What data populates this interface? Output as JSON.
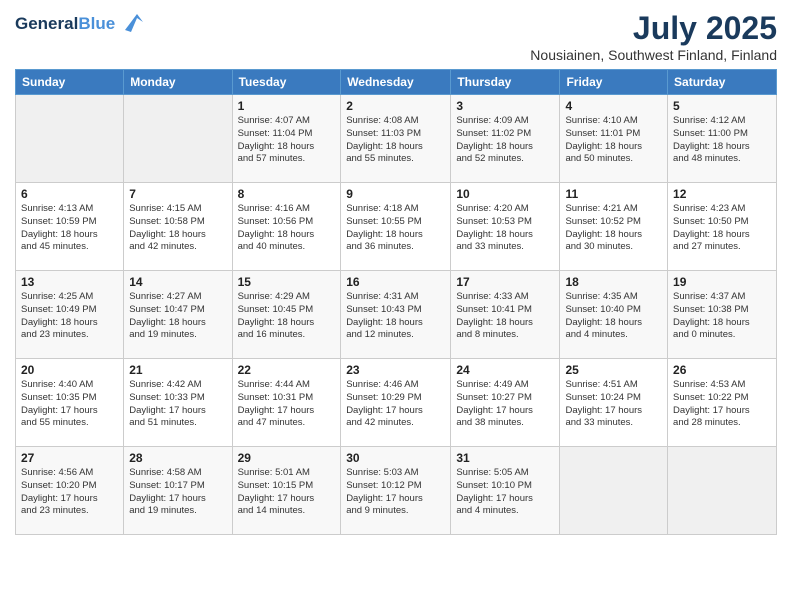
{
  "header": {
    "logo_line1": "General",
    "logo_line2": "Blue",
    "month": "July 2025",
    "location": "Nousiainen, Southwest Finland, Finland"
  },
  "weekdays": [
    "Sunday",
    "Monday",
    "Tuesday",
    "Wednesday",
    "Thursday",
    "Friday",
    "Saturday"
  ],
  "weeks": [
    [
      {
        "day": "",
        "info": ""
      },
      {
        "day": "",
        "info": ""
      },
      {
        "day": "1",
        "info": "Sunrise: 4:07 AM\nSunset: 11:04 PM\nDaylight: 18 hours\nand 57 minutes."
      },
      {
        "day": "2",
        "info": "Sunrise: 4:08 AM\nSunset: 11:03 PM\nDaylight: 18 hours\nand 55 minutes."
      },
      {
        "day": "3",
        "info": "Sunrise: 4:09 AM\nSunset: 11:02 PM\nDaylight: 18 hours\nand 52 minutes."
      },
      {
        "day": "4",
        "info": "Sunrise: 4:10 AM\nSunset: 11:01 PM\nDaylight: 18 hours\nand 50 minutes."
      },
      {
        "day": "5",
        "info": "Sunrise: 4:12 AM\nSunset: 11:00 PM\nDaylight: 18 hours\nand 48 minutes."
      }
    ],
    [
      {
        "day": "6",
        "info": "Sunrise: 4:13 AM\nSunset: 10:59 PM\nDaylight: 18 hours\nand 45 minutes."
      },
      {
        "day": "7",
        "info": "Sunrise: 4:15 AM\nSunset: 10:58 PM\nDaylight: 18 hours\nand 42 minutes."
      },
      {
        "day": "8",
        "info": "Sunrise: 4:16 AM\nSunset: 10:56 PM\nDaylight: 18 hours\nand 40 minutes."
      },
      {
        "day": "9",
        "info": "Sunrise: 4:18 AM\nSunset: 10:55 PM\nDaylight: 18 hours\nand 36 minutes."
      },
      {
        "day": "10",
        "info": "Sunrise: 4:20 AM\nSunset: 10:53 PM\nDaylight: 18 hours\nand 33 minutes."
      },
      {
        "day": "11",
        "info": "Sunrise: 4:21 AM\nSunset: 10:52 PM\nDaylight: 18 hours\nand 30 minutes."
      },
      {
        "day": "12",
        "info": "Sunrise: 4:23 AM\nSunset: 10:50 PM\nDaylight: 18 hours\nand 27 minutes."
      }
    ],
    [
      {
        "day": "13",
        "info": "Sunrise: 4:25 AM\nSunset: 10:49 PM\nDaylight: 18 hours\nand 23 minutes."
      },
      {
        "day": "14",
        "info": "Sunrise: 4:27 AM\nSunset: 10:47 PM\nDaylight: 18 hours\nand 19 minutes."
      },
      {
        "day": "15",
        "info": "Sunrise: 4:29 AM\nSunset: 10:45 PM\nDaylight: 18 hours\nand 16 minutes."
      },
      {
        "day": "16",
        "info": "Sunrise: 4:31 AM\nSunset: 10:43 PM\nDaylight: 18 hours\nand 12 minutes."
      },
      {
        "day": "17",
        "info": "Sunrise: 4:33 AM\nSunset: 10:41 PM\nDaylight: 18 hours\nand 8 minutes."
      },
      {
        "day": "18",
        "info": "Sunrise: 4:35 AM\nSunset: 10:40 PM\nDaylight: 18 hours\nand 4 minutes."
      },
      {
        "day": "19",
        "info": "Sunrise: 4:37 AM\nSunset: 10:38 PM\nDaylight: 18 hours\nand 0 minutes."
      }
    ],
    [
      {
        "day": "20",
        "info": "Sunrise: 4:40 AM\nSunset: 10:35 PM\nDaylight: 17 hours\nand 55 minutes."
      },
      {
        "day": "21",
        "info": "Sunrise: 4:42 AM\nSunset: 10:33 PM\nDaylight: 17 hours\nand 51 minutes."
      },
      {
        "day": "22",
        "info": "Sunrise: 4:44 AM\nSunset: 10:31 PM\nDaylight: 17 hours\nand 47 minutes."
      },
      {
        "day": "23",
        "info": "Sunrise: 4:46 AM\nSunset: 10:29 PM\nDaylight: 17 hours\nand 42 minutes."
      },
      {
        "day": "24",
        "info": "Sunrise: 4:49 AM\nSunset: 10:27 PM\nDaylight: 17 hours\nand 38 minutes."
      },
      {
        "day": "25",
        "info": "Sunrise: 4:51 AM\nSunset: 10:24 PM\nDaylight: 17 hours\nand 33 minutes."
      },
      {
        "day": "26",
        "info": "Sunrise: 4:53 AM\nSunset: 10:22 PM\nDaylight: 17 hours\nand 28 minutes."
      }
    ],
    [
      {
        "day": "27",
        "info": "Sunrise: 4:56 AM\nSunset: 10:20 PM\nDaylight: 17 hours\nand 23 minutes."
      },
      {
        "day": "28",
        "info": "Sunrise: 4:58 AM\nSunset: 10:17 PM\nDaylight: 17 hours\nand 19 minutes."
      },
      {
        "day": "29",
        "info": "Sunrise: 5:01 AM\nSunset: 10:15 PM\nDaylight: 17 hours\nand 14 minutes."
      },
      {
        "day": "30",
        "info": "Sunrise: 5:03 AM\nSunset: 10:12 PM\nDaylight: 17 hours\nand 9 minutes."
      },
      {
        "day": "31",
        "info": "Sunrise: 5:05 AM\nSunset: 10:10 PM\nDaylight: 17 hours\nand 4 minutes."
      },
      {
        "day": "",
        "info": ""
      },
      {
        "day": "",
        "info": ""
      }
    ]
  ]
}
